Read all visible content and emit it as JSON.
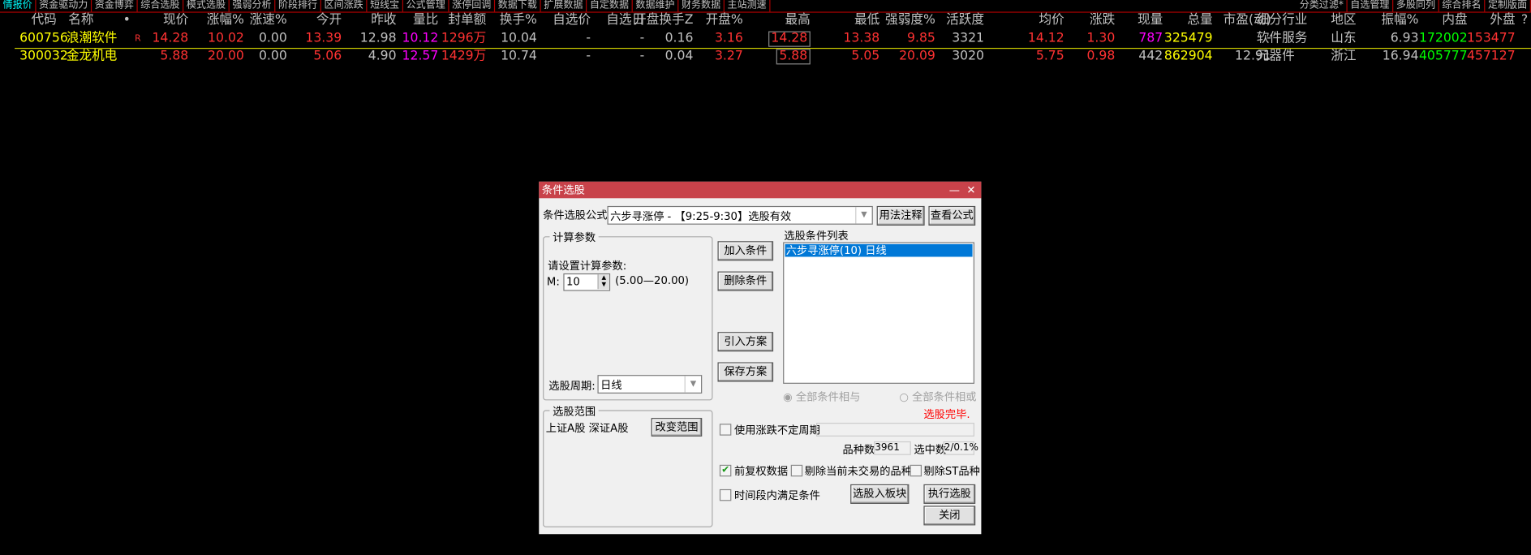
{
  "toolbar": {
    "left": [
      "情报价",
      "资金驱动力",
      "资金博弈",
      "综合选股",
      "模式选股",
      "强弱分析",
      "阶段排行",
      "区间涨跌",
      "短线宝",
      "公式管理",
      "涨停回调",
      "数据下载",
      "扩展数据",
      "自定数据",
      "数据维护",
      "财务数据",
      "主站测速"
    ],
    "right": [
      "分类过滤*",
      "自选管理",
      "多股同列",
      "综合排名",
      "定制版面"
    ]
  },
  "table": {
    "headers": [
      "代码",
      "名称",
      "•",
      "现价",
      "涨幅%",
      "涨速%",
      "今开",
      "昨收",
      "量比",
      "封单额",
      "换手%",
      "自选价",
      "自选日",
      "开盘换手Z",
      "开盘%",
      "最高",
      "最低",
      "强弱度%",
      "活跃度",
      "均价",
      "涨跌",
      "现量",
      "总量",
      "市盈(动)",
      "细分行业",
      "地区",
      "振幅%",
      "内盘",
      "外盘",
      "?"
    ],
    "rows": [
      [
        "600756",
        "浪潮软件",
        "R",
        "14.28",
        "10.02",
        "0.00",
        "13.39",
        "12.98",
        "10.12",
        "1296万",
        "10.04",
        "-",
        "-",
        "0.16",
        "3.16",
        "14.28",
        "13.38",
        "9.85",
        "3321",
        "14.12",
        "1.30",
        "787",
        "325479",
        "-",
        "软件服务",
        "山东",
        "6.93",
        "172002",
        "153477"
      ],
      [
        "300032",
        "金龙机电",
        "",
        "5.88",
        "20.00",
        "0.00",
        "5.06",
        "4.90",
        "12.57",
        "1429万",
        "10.74",
        "-",
        "-",
        "0.04",
        "3.27",
        "5.88",
        "5.05",
        "20.09",
        "3020",
        "5.75",
        "0.98",
        "442",
        "862904",
        "12.91",
        "元器件",
        "浙江",
        "16.94",
        "405777",
        "457127"
      ]
    ]
  },
  "dialog": {
    "title": "条件选股",
    "formula_label": "条件选股公式",
    "formula_value": "六步寻涨停   - 【9:25-9:30】选股有效",
    "usage_btn": "用法注释",
    "view_btn": "查看公式",
    "params_group": "计算参数",
    "params_prompt": "请设置计算参数:",
    "param_name": "M:",
    "param_value": "10",
    "param_range": "(5.00—20.00)",
    "period_label": "选股周期:",
    "period_value": "日线",
    "scope_group": "选股范围",
    "scope_value": "上证A股 深证A股",
    "scope_btn": "改变范围",
    "add_btn": "加入条件",
    "del_btn": "删除条件",
    "import_btn": "引入方案",
    "save_btn": "保存方案",
    "list_label": "选股条件列表",
    "list_items": [
      "六步寻涨停(10) 日线"
    ],
    "radio_and": "全部条件相与",
    "radio_or": "全部条件相或",
    "status": "选股完毕.",
    "chk_period": "使用涨跌不定周期",
    "count_label": "品种数",
    "count_value": "3961",
    "selected_label": "选中数",
    "selected_value": "2/0.1%",
    "chk_fq": "前复权数据",
    "chk_fq_checked": true,
    "chk_untraded": "剔除当前未交易的品种",
    "chk_st": "剔除ST品种",
    "chk_timespan": "时间段内满足条件",
    "to_block_btn": "选股入板块",
    "run_btn": "执行选股",
    "close_btn": "关闭"
  },
  "colors": {
    "up": "#ff3232",
    "volratio": "#ff00ff",
    "yellow": "#ffff00",
    "green": "#00ff00",
    "title_bar": "#c8424a",
    "selection": "#0078d7"
  }
}
